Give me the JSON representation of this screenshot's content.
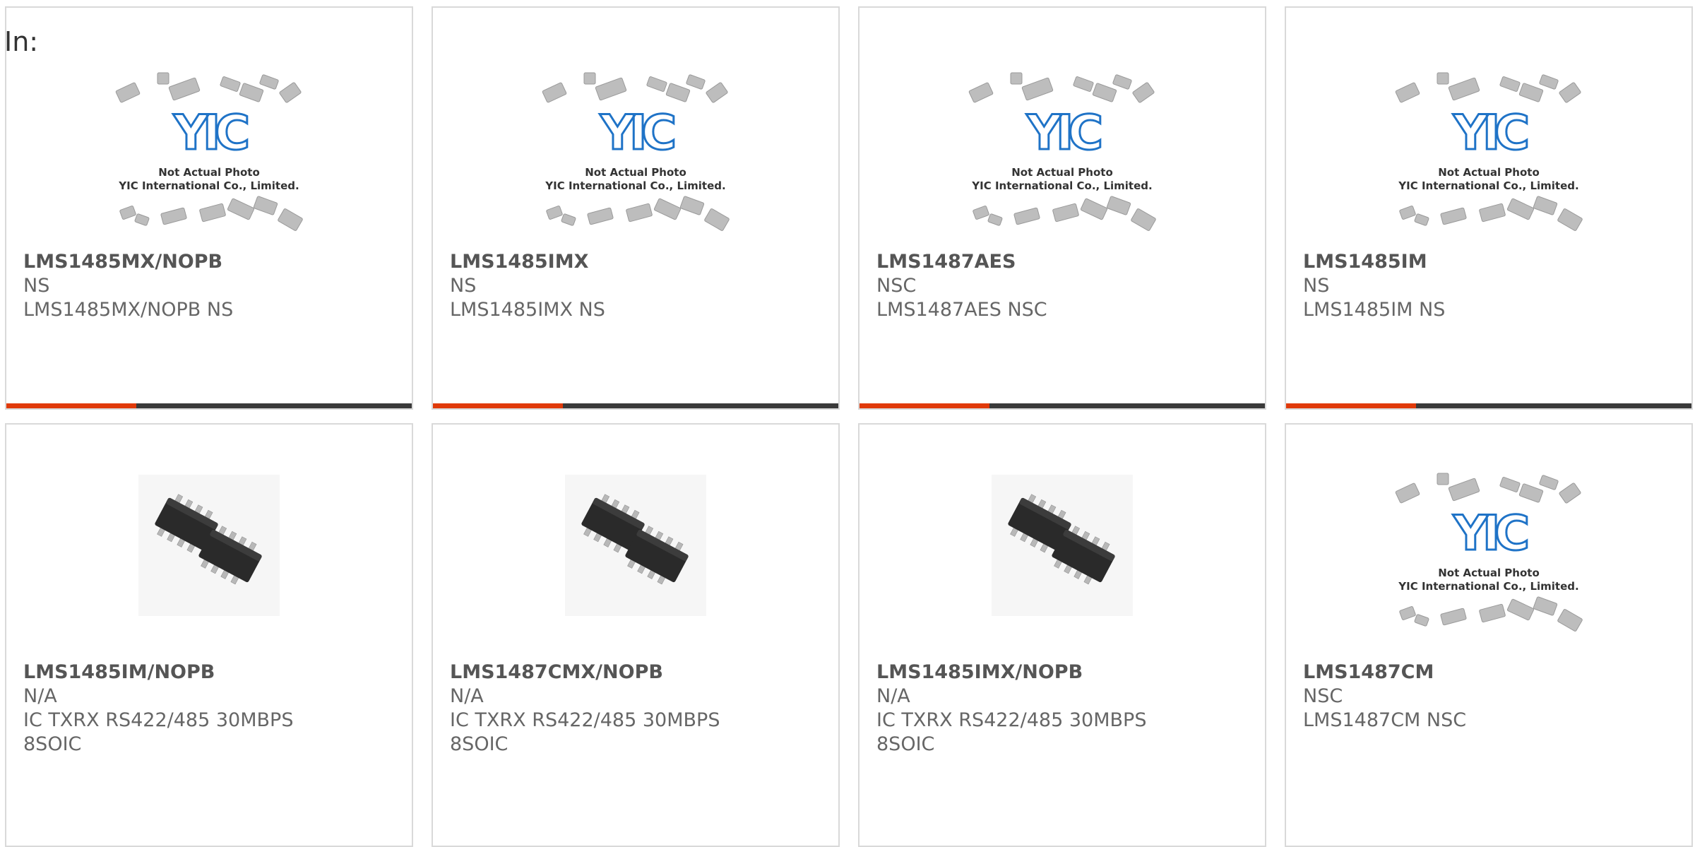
{
  "prefix_label": "In:",
  "colors": {
    "accent_bar": "#e03a0a",
    "base_bar": "#3a3a3a",
    "logo_blue": "#1f73c7",
    "card_border": "#d9d9d9"
  },
  "placeholder": {
    "line1": "Not Actual Photo",
    "line2": "YIC International Co., Limited.",
    "logo_text": "YIC"
  },
  "products": [
    {
      "part": "LMS1485MX/NOPB",
      "line1": "NS",
      "line2": "LMS1485MX/NOPB NS",
      "line3": "",
      "image": "yic-placeholder",
      "progress": 0.32
    },
    {
      "part": "LMS1485IMX",
      "line1": "NS",
      "line2": "LMS1485IMX NS",
      "line3": "",
      "image": "yic-placeholder",
      "progress": 0.32
    },
    {
      "part": "LMS1487AES",
      "line1": "NSC",
      "line2": "LMS1487AES NSC",
      "line3": "",
      "image": "yic-placeholder",
      "progress": 0.32
    },
    {
      "part": "LMS1485IM",
      "line1": "NS",
      "line2": "LMS1485IM NS",
      "line3": "",
      "image": "yic-placeholder",
      "progress": 0.32
    },
    {
      "part": "LMS1485IM/NOPB",
      "line1": "N/A",
      "line2": "IC TXRX RS422/485 30MBPS",
      "line3": "8SOIC",
      "image": "soic-chip-photo"
    },
    {
      "part": "LMS1487CMX/NOPB",
      "line1": "N/A",
      "line2": "IC TXRX RS422/485 30MBPS",
      "line3": "8SOIC",
      "image": "soic-chip-photo"
    },
    {
      "part": "LMS1485IMX/NOPB",
      "line1": "N/A",
      "line2": "IC TXRX RS422/485 30MBPS",
      "line3": "8SOIC",
      "image": "soic-chip-photo"
    },
    {
      "part": "LMS1487CM",
      "line1": "NSC",
      "line2": "LMS1487CM NSC",
      "line3": "",
      "image": "yic-placeholder"
    }
  ]
}
